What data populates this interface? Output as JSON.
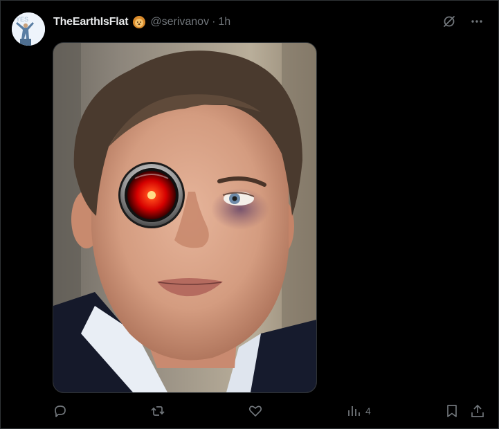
{
  "post": {
    "display_name": "TheEarthIsFlat",
    "handle": "@serivanov",
    "separator": "·",
    "time": "1h",
    "badge_icon": "lion-emoji-icon",
    "avatar_text": "YES"
  },
  "top_actions": {
    "grok_icon": "grok-icon",
    "more_icon": "more-icon"
  },
  "media": {
    "description_icon": "photo"
  },
  "actions": {
    "reply_icon": "reply-icon",
    "repost_icon": "repost-icon",
    "like_icon": "like-icon",
    "views_icon": "views-icon",
    "views_count": "4",
    "bookmark_icon": "bookmark-icon",
    "share_icon": "share-icon"
  },
  "colors": {
    "background": "#000000",
    "text_primary": "#e7e9ea",
    "text_secondary": "#71767b",
    "border": "#2f3336",
    "hal_red": "#ff1a00"
  }
}
